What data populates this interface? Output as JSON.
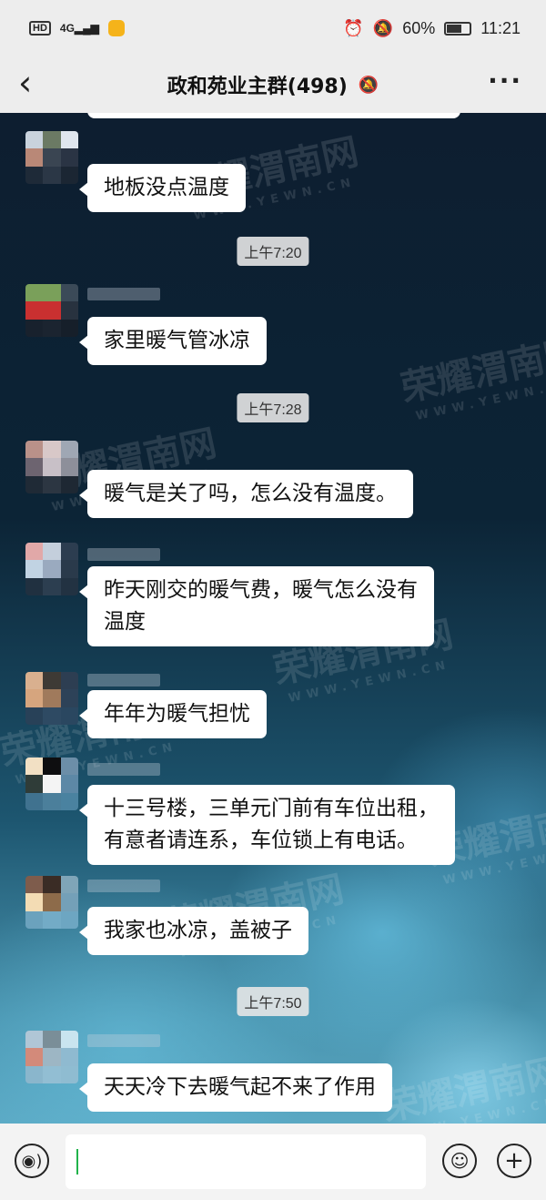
{
  "status_bar": {
    "hd": "HD",
    "network": "4G",
    "battery_percent": "60%",
    "time": "11:21"
  },
  "header": {
    "back_icon": "chevron-left-icon",
    "title": "政和苑业主群(498)",
    "muted_icon": "bell-off-icon",
    "more_icon": "more-dots-icon"
  },
  "watermark": {
    "text": "荣耀渭南网",
    "sub": "WWW.YEWN.CN"
  },
  "timestamps": [
    "上午7:20",
    "上午7:28",
    "上午7:50"
  ],
  "messages": [
    {
      "text": "地板没点温度"
    },
    {
      "text": "家里暖气管冰凉"
    },
    {
      "text": "暖气是关了吗，怎么没有温度。"
    },
    {
      "text": "昨天刚交的暖气费，暖气怎么没有\n温度"
    },
    {
      "text": "年年为暖气担忧"
    },
    {
      "text": "十三号楼，三单元门前有车位出租，\n有意者请连系，车位锁上有电话。"
    },
    {
      "text": "我家也冰凉，盖被子"
    },
    {
      "text": "天天冷下去暖气起不来了作用"
    }
  ],
  "input": {
    "voice_icon": "voice-icon",
    "emoji_icon": "emoji-icon",
    "plus_icon": "plus-icon",
    "value": ""
  },
  "colors": {
    "bar_bg": "#ededed",
    "bubble_bg": "#ffffff",
    "caret": "#21b34b"
  }
}
